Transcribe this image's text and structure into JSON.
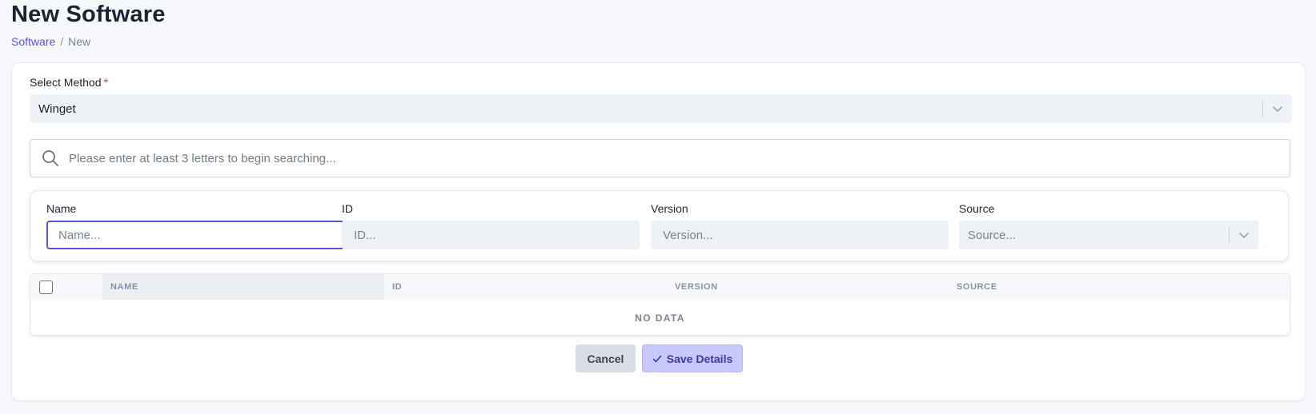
{
  "page": {
    "title": "New Software",
    "breadcrumb": {
      "parent": "Software",
      "separator": "/",
      "current": "New"
    }
  },
  "method": {
    "label": "Select Method",
    "required_marker": "*",
    "selected": "Winget"
  },
  "search": {
    "placeholder": "Please enter at least 3 letters to begin searching...",
    "value": ""
  },
  "filters": [
    {
      "label": "Name",
      "placeholder": "Name...",
      "value": ""
    },
    {
      "label": "ID",
      "placeholder": "ID...",
      "value": ""
    },
    {
      "label": "Version",
      "placeholder": "Version...",
      "value": ""
    },
    {
      "label": "Source",
      "placeholder": "Source...",
      "value": ""
    }
  ],
  "table": {
    "columns": [
      "NAME",
      "ID",
      "VERSION",
      "SOURCE"
    ],
    "rows": [],
    "empty_text": "NO DATA"
  },
  "actions": {
    "cancel": "Cancel",
    "save": "Save Details"
  },
  "colors": {
    "accent": "#5b55d6",
    "save_button_bg": "#c8c9fb",
    "cancel_button_bg": "#d9dde5",
    "required": "#e0455a"
  },
  "icons": {
    "search": "search-icon",
    "dropdown": "chevron-down-icon",
    "save": "check-icon"
  }
}
